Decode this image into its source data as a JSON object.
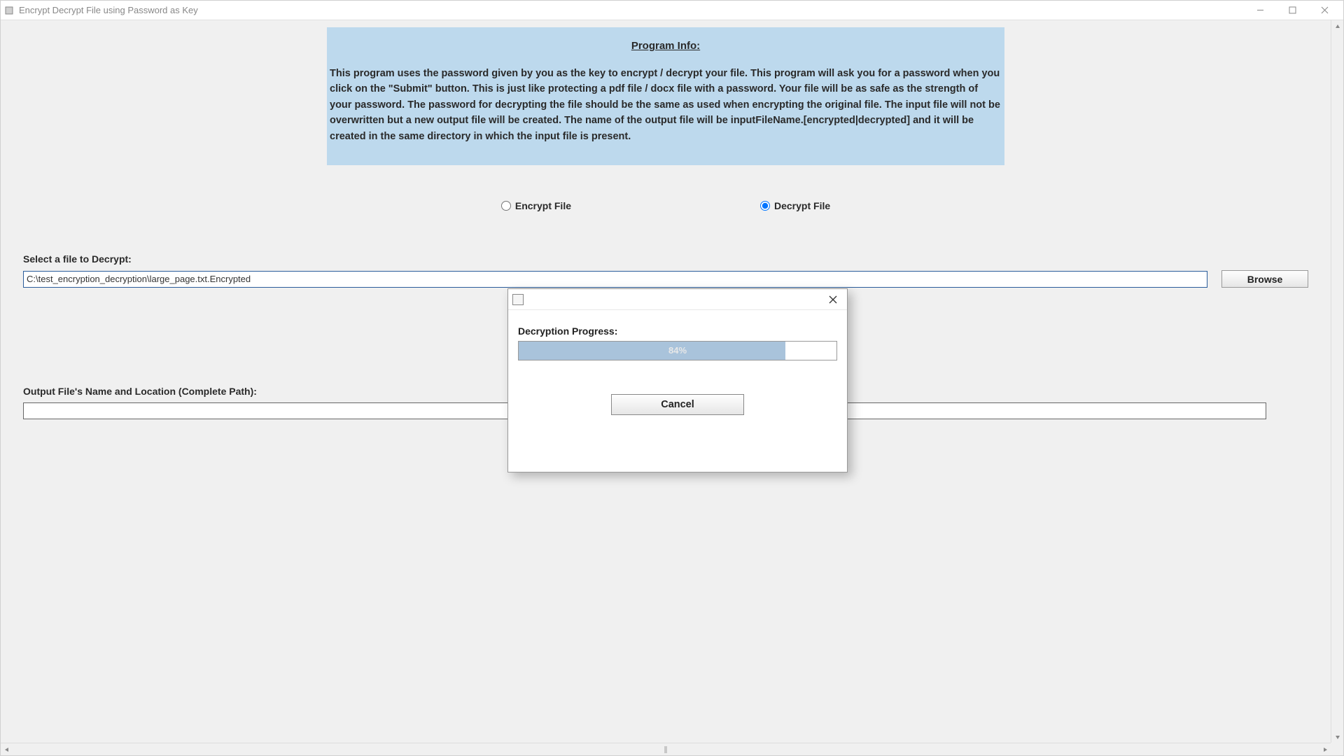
{
  "window": {
    "title": "Encrypt Decrypt File using Password as Key"
  },
  "info": {
    "heading": "Program Info:",
    "body": "This program uses the password given by you as the key to encrypt / decrypt your file. This program will ask you for a password when you click on the \"Submit\" button. This is just like protecting a pdf file / docx file with a password. Your file will be as safe as the strength of your password. The password for decrypting the file should be the same as used when encrypting the original file. The input file will not be overwritten but a new output file will be created. The name of the output file will be inputFileName.[encrypted|decrypted] and it will be created in the same directory in which the input file is present."
  },
  "radios": {
    "encrypt": "Encrypt File",
    "decrypt": "Decrypt File"
  },
  "file_select": {
    "label": "Select a file to Decrypt:",
    "value": "C:\\test_encryption_decryption\\large_page.txt.Encrypted",
    "browse": "Browse"
  },
  "output": {
    "label": "Output File's Name and Location (Complete Path):",
    "value": ""
  },
  "dialog": {
    "progress_label": "Decryption Progress:",
    "percent": 84,
    "percent_text": "84%",
    "cancel": "Cancel"
  }
}
